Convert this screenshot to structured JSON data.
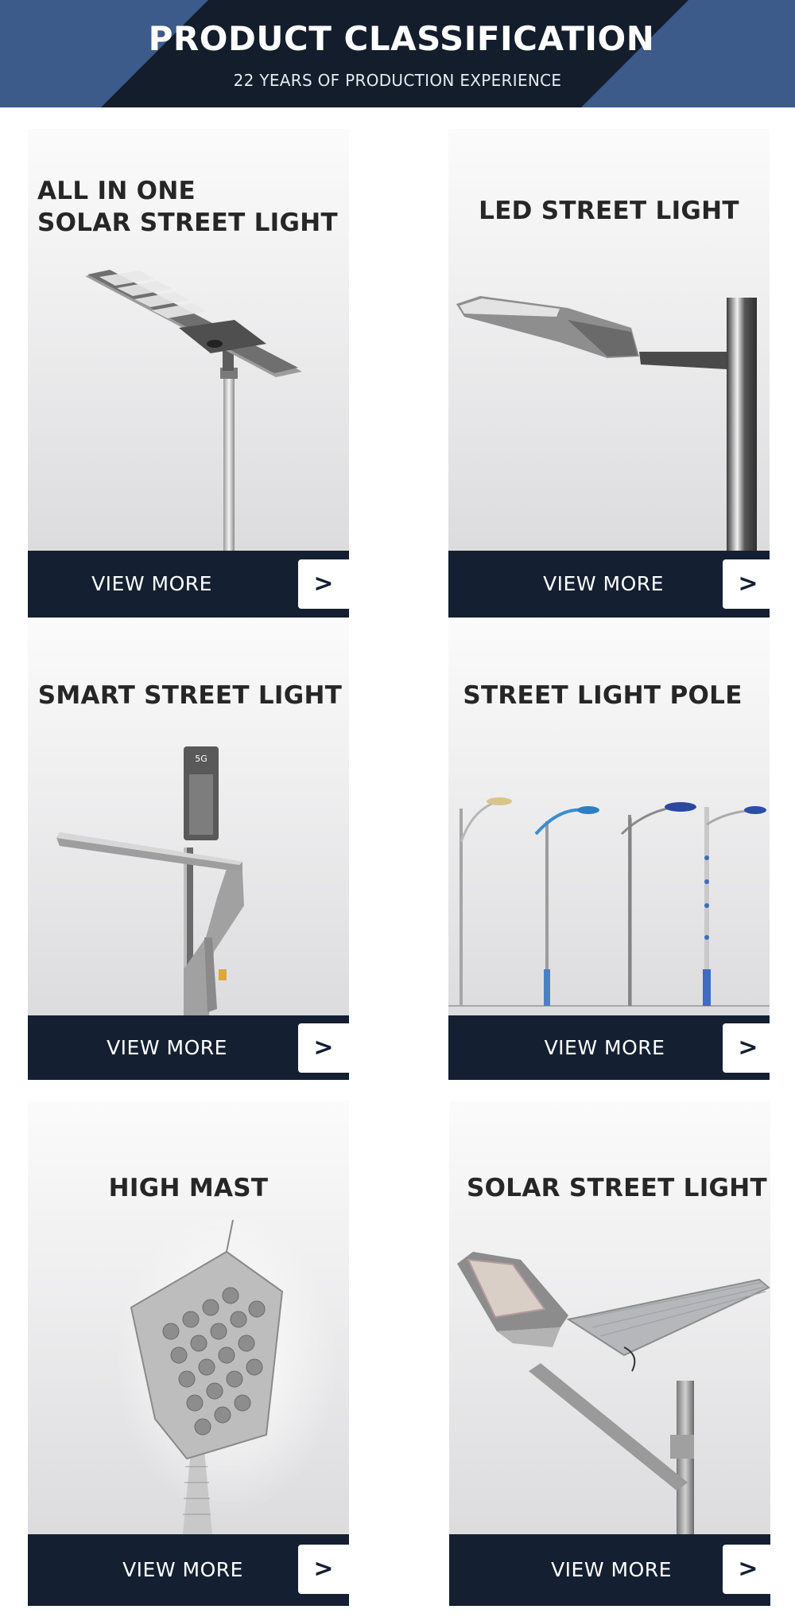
{
  "header": {
    "title": "PRODUCT CLASSIFICATION",
    "subtitle": "22 YEARS OF PRODUCTION EXPERIENCE",
    "colors": {
      "dark": "#131d2c",
      "accent": "#3c5a8a"
    }
  },
  "products": [
    {
      "title": "ALL IN ONE\nSOLAR STREET LIGHT",
      "button_label": "VIEW MORE",
      "arrow": ">",
      "icon": "all-in-one-solar-light-icon"
    },
    {
      "title": "LED  STREET LIGHT",
      "button_label": "VIEW MORE",
      "arrow": ">",
      "icon": "led-street-light-icon"
    },
    {
      "title": "SMART STREET LIGHT",
      "button_label": "VIEW MORE",
      "arrow": ">",
      "icon": "smart-street-light-icon",
      "badge": "5G"
    },
    {
      "title": "STREET LIGHT POLE",
      "button_label": "VIEW MORE",
      "arrow": ">",
      "icon": "street-light-pole-icon"
    },
    {
      "title": "HIGH MAST",
      "button_label": "VIEW MORE",
      "arrow": ">",
      "icon": "high-mast-icon"
    },
    {
      "title": "SOLAR STREET LIGHT",
      "button_label": "VIEW MORE",
      "arrow": ">",
      "icon": "solar-street-light-icon"
    }
  ],
  "colors": {
    "bar": "#142031",
    "title_text": "#262626"
  }
}
